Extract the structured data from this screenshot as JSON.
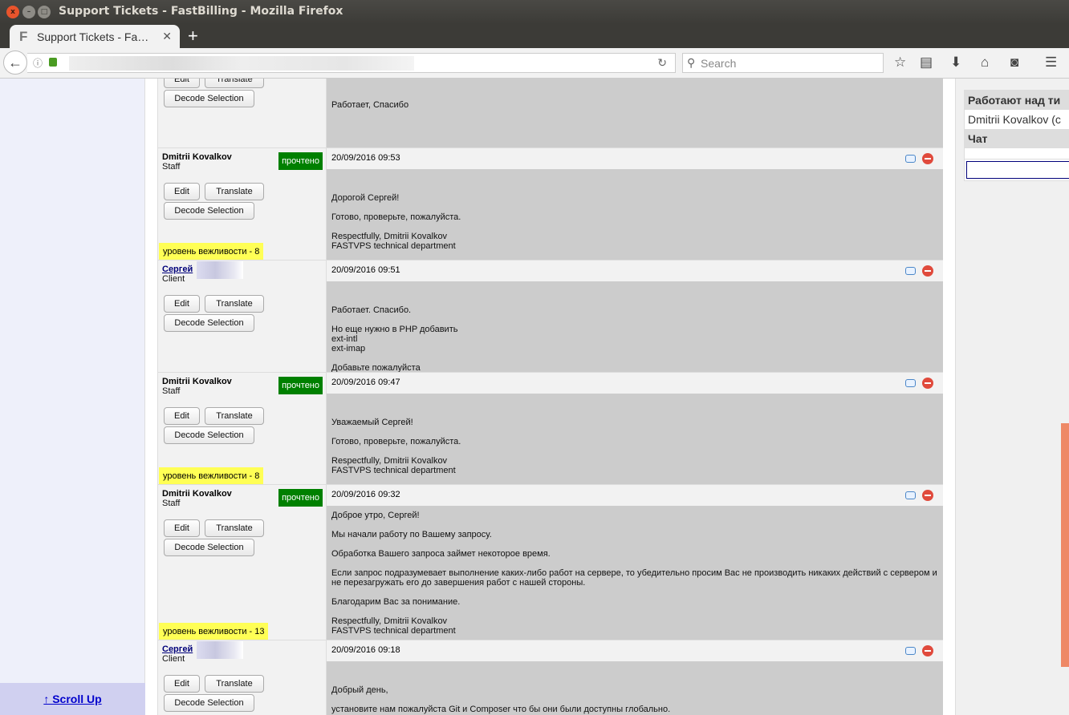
{
  "window": {
    "title": "Support Tickets - FastBilling - Mozilla Firefox"
  },
  "tab": {
    "label": "Support Tickets - Fa…",
    "favicon": "F"
  },
  "toolbar": {
    "search_placeholder": "Search"
  },
  "sidebar": {
    "scroll_up": "↑ Scroll Up"
  },
  "buttons": {
    "edit": "Edit",
    "translate": "Translate",
    "decode": "Decode Selection"
  },
  "right_panel": {
    "working_header": "Работают над ти",
    "working_value": "Dmitrii Kovalkov (c",
    "chat_header": "Чат"
  },
  "colors": {
    "badge": "#008000",
    "politeness": "#ffff55",
    "scrollbar": "#ee8866"
  },
  "messages": [
    {
      "body": [
        "",
        "",
        "Работает, Спасибо"
      ]
    },
    {
      "author": "Dmitrii Kovalkov",
      "role": "Staff",
      "badge": "прочтено",
      "date": "20/09/2016 09:53",
      "politeness": "уровень вежливости - 8",
      "body": [
        "",
        "Дорогой Сергей!",
        "Готово, проверьте, пожалуйста.",
        "Respectfully, Dmitrii Kovalkov\nFASTVPS technical department"
      ]
    },
    {
      "author": "Сергей",
      "role": "Client",
      "date": "20/09/2016 09:51",
      "body": [
        "",
        "Работает. Спасибо.",
        "Но еще нужно в PHP добавить\next-intl\next-imap",
        "Добавьте пожалуйста"
      ]
    },
    {
      "author": "Dmitrii Kovalkov",
      "role": "Staff",
      "badge": "прочтено",
      "date": "20/09/2016 09:47",
      "politeness": "уровень вежливости - 8",
      "body": [
        "",
        "Уважаемый Сергей!",
        "Готово, проверьте, пожалуйста.",
        "Respectfully, Dmitrii Kovalkov\nFASTVPS technical department"
      ]
    },
    {
      "author": "Dmitrii Kovalkov",
      "role": "Staff",
      "badge": "прочтено",
      "date": "20/09/2016 09:32",
      "politeness": "уровень вежливости - 13",
      "body": [
        "Доброе утро, Сергей!",
        "Мы начали работу по Вашему запросу.",
        "Обработка Вашего запроса займет некоторое время.",
        "Если запрос подразумевает выполнение каких-либо работ на сервере, то убедительно просим Вас не производить никаких действий с сервером и не перезагружать его до завершения работ с нашей стороны.",
        "Благодарим Вас за понимание.",
        "Respectfully, Dmitrii Kovalkov\nFASTVPS technical department"
      ]
    },
    {
      "author": "Сергей",
      "role": "Client",
      "date": "20/09/2016 09:18",
      "body": [
        "",
        "Добрый день,",
        "установите нам пожалуйста Git и Composer что бы они были доступны глобально."
      ]
    }
  ]
}
